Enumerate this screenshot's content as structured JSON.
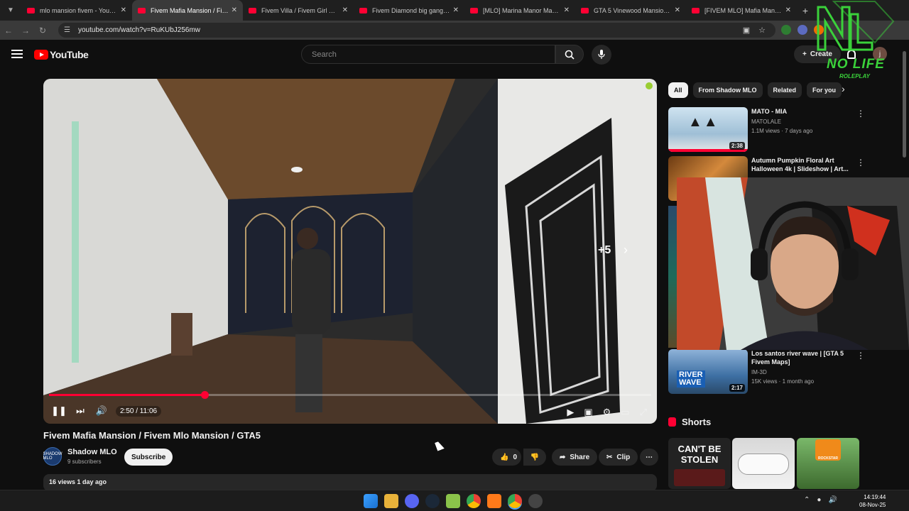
{
  "browser": {
    "tabs": [
      {
        "title": "mlo mansion fivem - YouTube",
        "active": false
      },
      {
        "title": "Fivem Mafia Mansion / Fivem M",
        "active": true
      },
      {
        "title": "Fivem Villa / Fivem Girl Mansio",
        "active": false
      },
      {
        "title": "Fivem Diamond big gang man",
        "active": false
      },
      {
        "title": "[MLO] Marina Manor Mansion/",
        "active": false
      },
      {
        "title": "GTA 5 Vinewood Mansion 4 - F",
        "active": false
      },
      {
        "title": "[FIVEM MLO] Mafia Mansion -",
        "active": false
      }
    ],
    "url": "youtube.com/watch?v=RuKUbJ256mw"
  },
  "header": {
    "logo_text": "YouTube",
    "search_placeholder": "Search",
    "create_label": "Create",
    "avatar_letter": "j"
  },
  "player": {
    "time": "2:50 / 11:06",
    "progress": 0.258,
    "next_count": "+5"
  },
  "video": {
    "title": "Fivem Mafia Mansion / Fivem Mlo Mansion / GTA5",
    "channel_name": "Shadow MLO",
    "channel_avatar_text": "SHADOW MLO",
    "subscribers": "9 subscribers",
    "subscribe_label": "Subscribe",
    "likes": "0",
    "share_label": "Share",
    "clip_label": "Clip",
    "views_date": "16 views  1 day ago"
  },
  "chips": [
    "All",
    "From Shadow MLO",
    "Related",
    "For you"
  ],
  "recommendations": [
    {
      "title": "MATO - MIA",
      "channel": "MATOLALE",
      "meta": "1.1M views · 7 days ago",
      "duration": "2:38"
    },
    {
      "title": "Autumn Pumpkin Floral Art Halloween 4k | Slideshow | Art...",
      "channel": "",
      "meta": "",
      "duration": ""
    },
    {
      "title": "Los santos river wave | [GTA 5 Fivem Maps]",
      "channel": "IM-3D",
      "meta": "15K views · 1 month ago",
      "duration": "2:17"
    }
  ],
  "shorts": {
    "heading": "Shorts",
    "items": [
      "CAN'T BE STOLEN",
      "",
      "ROCKSTAR"
    ]
  },
  "overlay_logo": {
    "brand": "NO LIFE",
    "sub": "ROLEPLAY"
  },
  "taskbar": {
    "time": "14:19:44",
    "date": "08-Nov-25"
  },
  "colors": {
    "accent": "#ff0033",
    "logo_green": "#3ad13a",
    "background": "#0f0f0f"
  }
}
